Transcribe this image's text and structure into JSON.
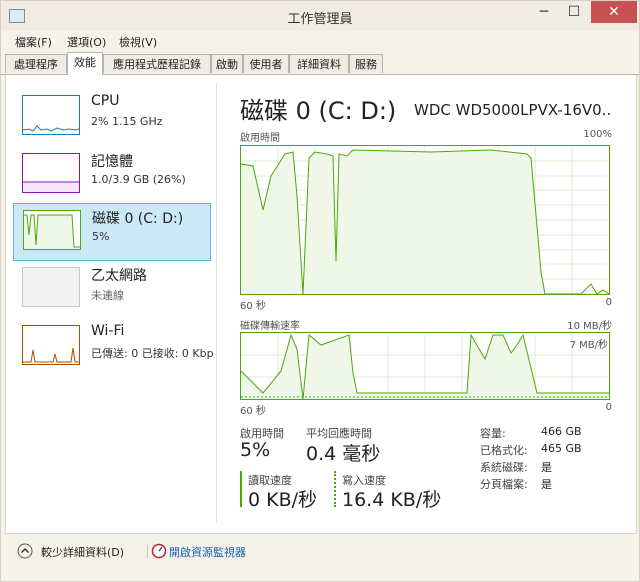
{
  "window": {
    "title": "工作管理員",
    "min_glyph": "─",
    "max_glyph": "☐",
    "close_glyph": "✕"
  },
  "menu": [
    {
      "label": "檔案(F)"
    },
    {
      "label": "選項(O)"
    },
    {
      "label": "檢視(V)"
    }
  ],
  "tabs": [
    {
      "label": "處理程序"
    },
    {
      "label": "效能"
    },
    {
      "label": "應用程式歷程記錄"
    },
    {
      "label": "啟動"
    },
    {
      "label": "使用者"
    },
    {
      "label": "詳細資料"
    },
    {
      "label": "服務"
    }
  ],
  "sidebar": {
    "items": [
      {
        "name": "CPU",
        "sub": "2% 1.15 GHz"
      },
      {
        "name": "記憶體",
        "sub": "1.0/3.9 GB (26%)"
      },
      {
        "name": "磁碟 0 (C: D:)",
        "sub": "5%"
      },
      {
        "name": "乙太網路",
        "sub": "未連線"
      },
      {
        "name": "Wi-Fi",
        "sub": "已傳送: 0 已接收: 0 Kbps"
      }
    ]
  },
  "main": {
    "title": "磁碟 0 (C: D:)",
    "model": "WDC WD5000LPVX-16V0...",
    "chart1": {
      "label": "啟用時間",
      "max": "100%",
      "time": "60 秒",
      "min": "0"
    },
    "chart2": {
      "label": "磁碟傳輸速率",
      "max": "10 MB/秒",
      "sub_max": "7 MB/秒",
      "time": "60 秒",
      "min": "0"
    },
    "stats": {
      "active_label": "啟用時間",
      "active_value": "5%",
      "resp_label": "平均回應時間",
      "resp_value": "0.4 毫秒",
      "read_label": "讀取速度",
      "read_value": "0 KB/秒",
      "write_label": "寫入速度",
      "write_value": "16.4 KB/秒"
    },
    "props": [
      {
        "k": "容量:",
        "v": "466 GB"
      },
      {
        "k": "已格式化:",
        "v": "465 GB"
      },
      {
        "k": "系統磁碟:",
        "v": "是"
      },
      {
        "k": "分頁檔案:",
        "v": "是"
      }
    ]
  },
  "footer": {
    "fewer_details": "較少詳細資料(D)",
    "resource_monitor": "開啟資源監視器"
  },
  "colors": {
    "disk_line": "#4da60c",
    "disk_fill": "#eff7e8",
    "cpu": "#117dbb",
    "memory": "#8b12ae",
    "wifi": "#a74f01",
    "ethernet_border": "#c8c8c8"
  }
}
